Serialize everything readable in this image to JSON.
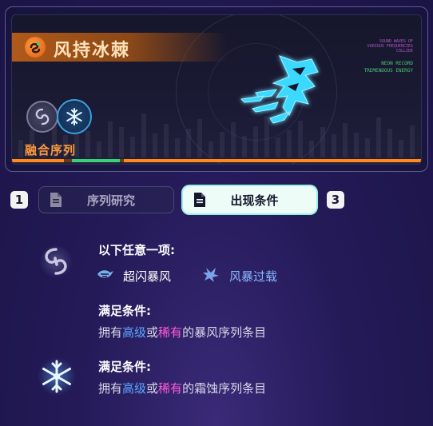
{
  "card": {
    "title": "风持冰棘",
    "fusion_label": "融合序列",
    "deco_small_lines": [
      "SOUND WAVES OF",
      "VARIOUS FREQUENCIES",
      "COLLIDE"
    ],
    "deco_green_lines": [
      "NEON RECORD",
      "TREMENDOUS ENERGY"
    ]
  },
  "tabs": {
    "left_number": "1",
    "right_number": "3",
    "items": [
      {
        "label": "序列研究",
        "active": false
      },
      {
        "label": "出现条件",
        "active": true
      }
    ]
  },
  "conditions": {
    "any_one_heading": "以下任意一项:",
    "options": [
      {
        "label": "超闪暴风",
        "icon": "storm-flash-icon"
      },
      {
        "label": "风暴过载",
        "icon": "storm-overload-icon"
      }
    ],
    "wind_requirement": {
      "heading": "满足条件:",
      "prefix": "拥有",
      "tier1": "高级",
      "or": "或",
      "tier2": "稀有",
      "suffix": "的暴风序列条目"
    },
    "frost_requirement": {
      "heading": "满足条件:",
      "prefix": "拥有",
      "tier1": "高级",
      "or": "或",
      "tier2": "稀有",
      "suffix": "的霜蚀序列条目"
    }
  },
  "colors": {
    "accent_orange": "#ff8a1a",
    "accent_green": "#38d07a",
    "tier_advanced": "#5aa8ff",
    "tier_rare": "#ff5ad8",
    "ice_cyan": "#3ad8ff"
  }
}
